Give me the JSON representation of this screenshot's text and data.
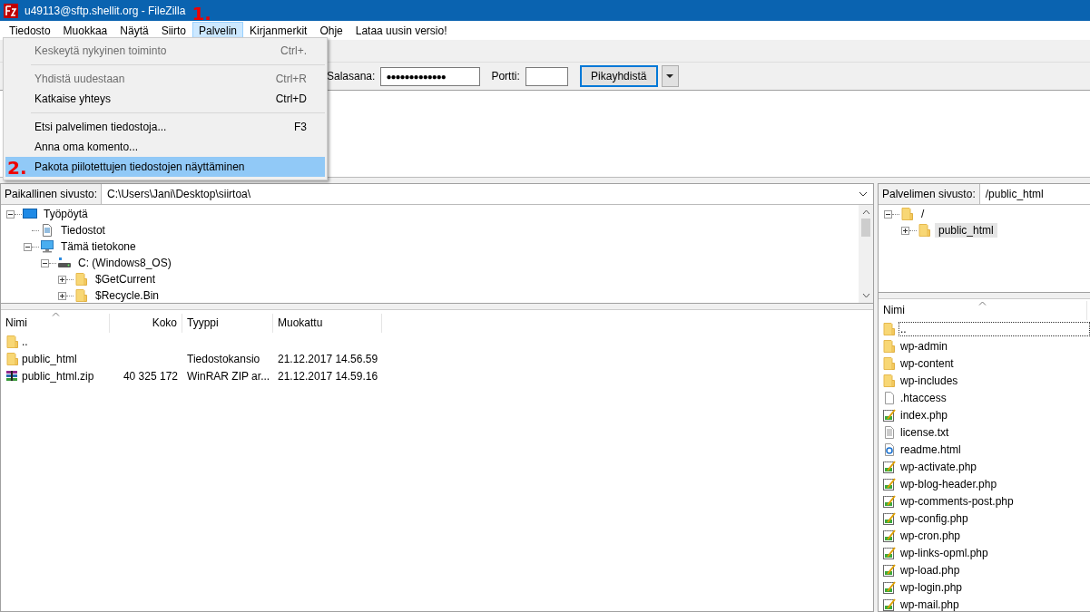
{
  "window": {
    "title": "u49113@sftp.shellit.org - FileZilla",
    "annotation": "1."
  },
  "menu_bar": [
    {
      "label": "Tiedosto",
      "selected": false
    },
    {
      "label": "Muokkaa",
      "selected": false
    },
    {
      "label": "Näytä",
      "selected": false
    },
    {
      "label": "Siirto",
      "selected": false
    },
    {
      "label": "Palvelin",
      "selected": true
    },
    {
      "label": "Kirjanmerkit",
      "selected": false
    },
    {
      "label": "Ohje",
      "selected": false
    },
    {
      "label": "Lataa uusin versio!",
      "selected": false
    }
  ],
  "open_menu": [
    {
      "kind": "item",
      "label": "Keskeytä nykyinen toiminto",
      "shortcut": "Ctrl+.",
      "disabled": true,
      "selected": false
    },
    {
      "kind": "separator"
    },
    {
      "kind": "item",
      "label": "Yhdistä uudestaan",
      "shortcut": "Ctrl+R",
      "disabled": true,
      "selected": false
    },
    {
      "kind": "item",
      "label": "Katkaise yhteys",
      "shortcut": "Ctrl+D",
      "disabled": false,
      "selected": false
    },
    {
      "kind": "separator"
    },
    {
      "kind": "item",
      "label": "Etsi palvelimen tiedostoja...",
      "shortcut": "F3",
      "disabled": false,
      "selected": false
    },
    {
      "kind": "item",
      "label": "Anna oma komento...",
      "disabled": false,
      "selected": false
    },
    {
      "kind": "item",
      "label": "Pakota piilotettujen tiedostojen näyttäminen",
      "disabled": false,
      "selected": true,
      "annotation": "2."
    }
  ],
  "quickconnect": {
    "password_label": "Salasana:",
    "password_value": "●●●●●●●●●●●●●",
    "port_label": "Portti:",
    "button": "Pikayhdistä"
  },
  "local": {
    "site_label": "Paikallinen sivusto:",
    "path": "C:\\Users\\Jani\\Desktop\\siirtoa\\",
    "tree": [
      {
        "kind": "desktop",
        "label": "Työpöytä",
        "expanded": true,
        "selected": false,
        "children": [
          {
            "kind": "documents",
            "label": "Tiedostot",
            "selected": false
          },
          {
            "kind": "computer",
            "label": "Tämä tietokone",
            "expanded": true,
            "selected": false,
            "children": [
              {
                "kind": "drive",
                "label": "C: (Windows8_OS)",
                "expanded": true,
                "selected": false,
                "children": [
                  {
                    "kind": "folder",
                    "label": "$GetCurrent",
                    "expanded": false,
                    "selected": false
                  },
                  {
                    "kind": "folder",
                    "label": "$Recycle.Bin",
                    "expanded": false,
                    "selected": false
                  }
                ]
              }
            ]
          }
        ]
      }
    ],
    "columns": [
      "Nimi",
      "Koko",
      "Tyyppi",
      "Muokattu"
    ],
    "rows": [
      {
        "kind": "folder",
        "name": ".."
      },
      {
        "kind": "folder",
        "name": "public_html",
        "type": "Tiedostokansio",
        "modified": "21.12.2017 14.56.59"
      },
      {
        "kind": "zip",
        "name": "public_html.zip",
        "size": "40 325 172",
        "type": "WinRAR ZIP ar...",
        "modified": "21.12.2017 14.59.16"
      }
    ]
  },
  "remote": {
    "site_label": "Palvelimen sivusto:",
    "path": "/public_html",
    "tree": [
      {
        "kind": "folder",
        "label": "/",
        "expanded": true,
        "selected": false,
        "children": [
          {
            "kind": "folder",
            "label": "public_html",
            "expanded": false,
            "selected": true
          }
        ]
      }
    ],
    "columns": [
      "Nimi"
    ],
    "rows": [
      {
        "kind": "folder",
        "name": "..",
        "focused": true
      },
      {
        "kind": "folder",
        "name": "wp-admin",
        "focused": false
      },
      {
        "kind": "folder",
        "name": "wp-content",
        "focused": false
      },
      {
        "kind": "folder",
        "name": "wp-includes",
        "focused": false
      },
      {
        "kind": "file",
        "name": ".htaccess",
        "focused": false
      },
      {
        "kind": "php",
        "name": "index.php",
        "focused": false
      },
      {
        "kind": "txt",
        "name": "license.txt",
        "focused": false
      },
      {
        "kind": "html",
        "name": "readme.html",
        "focused": false
      },
      {
        "kind": "php",
        "name": "wp-activate.php",
        "focused": false
      },
      {
        "kind": "php",
        "name": "wp-blog-header.php",
        "focused": false
      },
      {
        "kind": "php",
        "name": "wp-comments-post.php",
        "focused": false
      },
      {
        "kind": "php",
        "name": "wp-config.php",
        "focused": false
      },
      {
        "kind": "php",
        "name": "wp-cron.php",
        "focused": false
      },
      {
        "kind": "php",
        "name": "wp-links-opml.php",
        "focused": false
      },
      {
        "kind": "php",
        "name": "wp-load.php",
        "focused": false
      },
      {
        "kind": "php",
        "name": "wp-login.php",
        "focused": false
      },
      {
        "kind": "php",
        "name": "wp-mail.php",
        "focused": false
      }
    ]
  }
}
